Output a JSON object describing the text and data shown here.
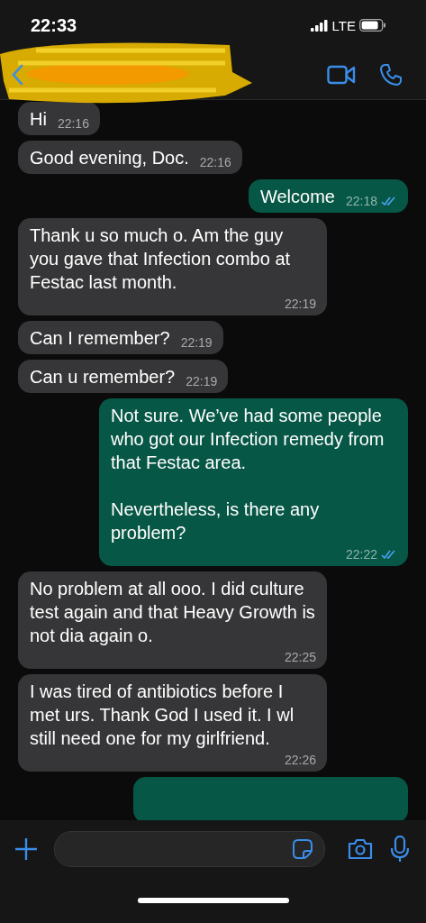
{
  "status_bar": {
    "time": "22:33",
    "network": "LTE"
  },
  "messages": [
    {
      "kind": "incoming",
      "text": "Hi",
      "time": "22:16"
    },
    {
      "kind": "incoming",
      "text": "Good evening, Doc.",
      "time": "22:16"
    },
    {
      "kind": "outgoing",
      "text": "Welcome",
      "time": "22:18",
      "read": true
    },
    {
      "kind": "incoming",
      "text": "Thank u so much o. Am the guy you gave that Infection combo at Festac last month.",
      "time": "22:19"
    },
    {
      "kind": "incoming",
      "text": "Can I remember?",
      "time": "22:19"
    },
    {
      "kind": "incoming",
      "text": "Can u remember?",
      "time": "22:19"
    },
    {
      "kind": "outgoing",
      "text": "Not sure. We’ve had some people who got our Infection remedy from that Festac area.\n\nNevertheless, is there any problem?",
      "time": "22:22",
      "read": true
    },
    {
      "kind": "incoming",
      "text": "No problem at all ooo. I did culture test again and that Heavy Growth is not dia again o.",
      "time": "22:25"
    },
    {
      "kind": "incoming",
      "text": "I was tired of antibiotics before I met urs. Thank God I used it. I wl still need one for my girlfriend.",
      "time": "22:26"
    }
  ]
}
